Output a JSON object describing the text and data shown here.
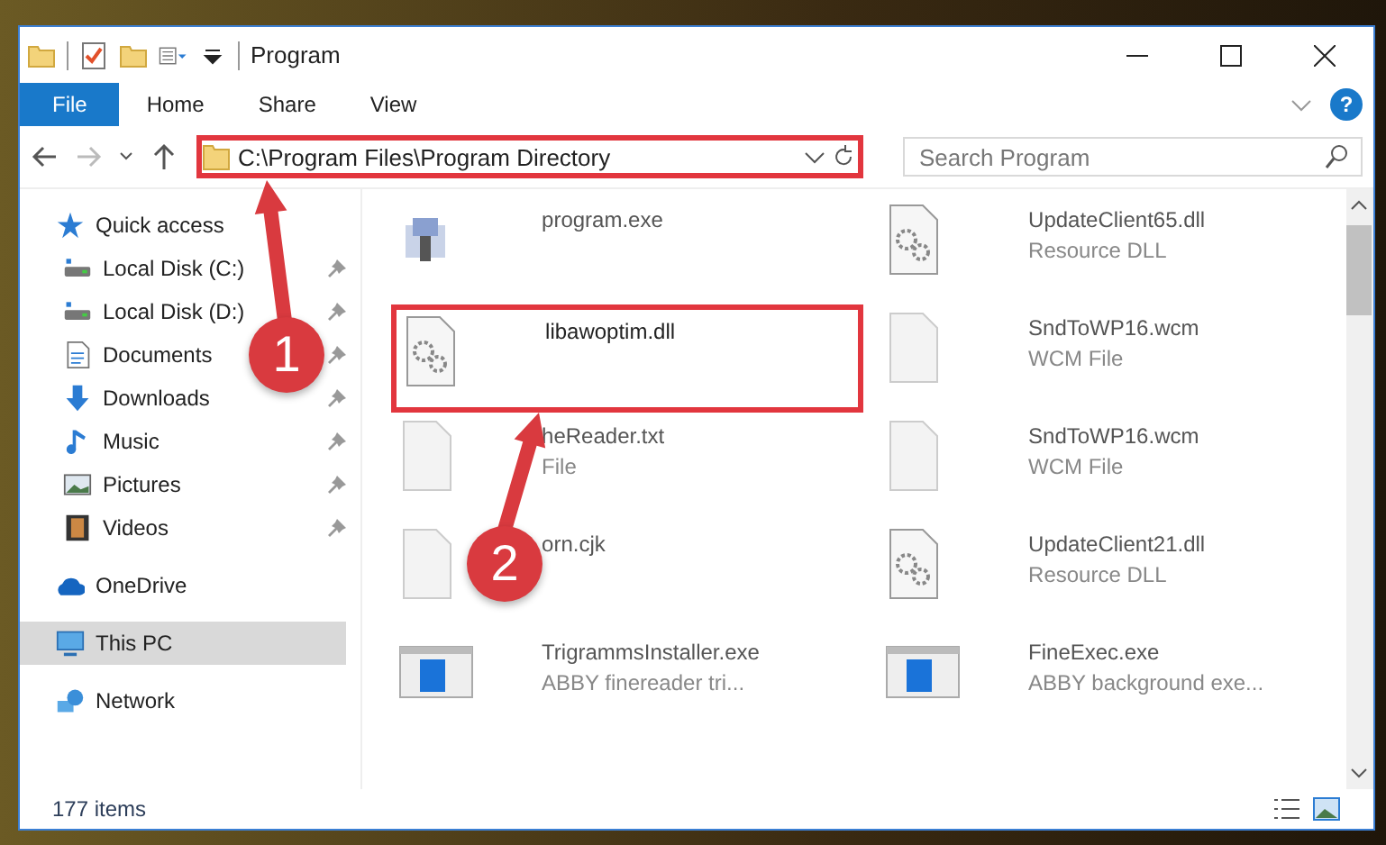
{
  "window": {
    "title": "Program"
  },
  "ribbon_tabs": [
    {
      "label": "File",
      "selected": true
    },
    {
      "label": "Home",
      "selected": false
    },
    {
      "label": "Share",
      "selected": false
    },
    {
      "label": "View",
      "selected": false
    }
  ],
  "help": "?",
  "address": {
    "path": "C:\\Program Files\\Program Directory",
    "highlighted": true
  },
  "search": {
    "placeholder": "Search Program"
  },
  "sidebar": {
    "items": [
      {
        "label": "Quick access",
        "kind": "star",
        "selected": false,
        "children": [
          {
            "label": "Local Disk (C:)",
            "kind": "drive",
            "pinned": true,
            "selected": false
          },
          {
            "label": "Local Disk (D:)",
            "kind": "drive",
            "pinned": true,
            "selected": false
          },
          {
            "label": "Documents",
            "kind": "document",
            "pinned": true,
            "selected": false
          },
          {
            "label": "Downloads",
            "kind": "download",
            "pinned": true,
            "selected": false
          },
          {
            "label": "Music",
            "kind": "music",
            "pinned": true,
            "selected": false
          },
          {
            "label": "Pictures",
            "kind": "pictures",
            "pinned": true,
            "selected": false
          },
          {
            "label": "Videos",
            "kind": "videos",
            "pinned": true,
            "selected": false
          }
        ]
      },
      {
        "label": "OneDrive",
        "kind": "cloud",
        "selected": false
      },
      {
        "label": "This PC",
        "kind": "computer",
        "selected": true
      },
      {
        "label": "Network",
        "kind": "network",
        "selected": false
      }
    ]
  },
  "files": [
    {
      "name": "program.exe",
      "kind": "app",
      "highlighted": false
    },
    {
      "name": "UpdateClient65.dll",
      "type": "Resource DLL",
      "kind": "dll",
      "highlighted": false
    },
    {
      "name": "libawoptim.dll",
      "kind": "dll",
      "highlighted": true
    },
    {
      "name": "SndToWP16.wcm",
      "type": "WCM File",
      "kind": "blank",
      "highlighted": false
    },
    {
      "name": "heReader.txt",
      "type": "File",
      "kind": "blank",
      "highlighted": false
    },
    {
      "name": "SndToWP16.wcm",
      "type": "WCM File",
      "kind": "blank",
      "highlighted": false
    },
    {
      "name": "orn.cjk",
      "kind": "blank",
      "highlighted": false
    },
    {
      "name": "UpdateClient21.dll",
      "type": "Resource DLL",
      "kind": "dll",
      "highlighted": false
    },
    {
      "name": "TrigrammsInstaller.exe",
      "type": "ABBY finereader tri...",
      "kind": "installer",
      "highlighted": false
    },
    {
      "name": "FineExec.exe",
      "type": "ABBY background exe...",
      "kind": "installer",
      "highlighted": false
    }
  ],
  "status_bar": {
    "item_count": "177 items"
  },
  "annotations": [
    {
      "label": "1"
    },
    {
      "label": "2"
    }
  ]
}
